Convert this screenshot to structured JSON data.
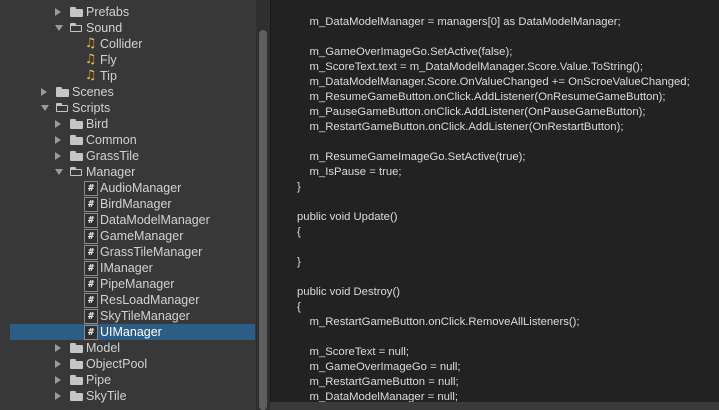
{
  "tree": {
    "items": [
      {
        "label": "Prefabs",
        "kind": "folder",
        "indent": 1,
        "arrow": "closed"
      },
      {
        "label": "Sound",
        "kind": "folder",
        "indent": 1,
        "arrow": "open"
      },
      {
        "label": "Collider",
        "kind": "audio",
        "indent": 2
      },
      {
        "label": "Fly",
        "kind": "audio",
        "indent": 2
      },
      {
        "label": "Tip",
        "kind": "audio",
        "indent": 2
      },
      {
        "label": "Scenes",
        "kind": "folder",
        "indent": 0,
        "arrow": "closed"
      },
      {
        "label": "Scripts",
        "kind": "folder",
        "indent": 0,
        "arrow": "open"
      },
      {
        "label": "Bird",
        "kind": "folder",
        "indent": 1,
        "arrow": "closed"
      },
      {
        "label": "Common",
        "kind": "folder",
        "indent": 1,
        "arrow": "closed"
      },
      {
        "label": "GrassTile",
        "kind": "folder",
        "indent": 1,
        "arrow": "closed"
      },
      {
        "label": "Manager",
        "kind": "folder",
        "indent": 1,
        "arrow": "open"
      },
      {
        "label": "AudioManager",
        "kind": "script",
        "indent": 2
      },
      {
        "label": "BirdManager",
        "kind": "script",
        "indent": 2
      },
      {
        "label": "DataModelManager",
        "kind": "script",
        "indent": 2
      },
      {
        "label": "GameManager",
        "kind": "script",
        "indent": 2
      },
      {
        "label": "GrassTileManager",
        "kind": "script",
        "indent": 2
      },
      {
        "label": "IManager",
        "kind": "script",
        "indent": 2
      },
      {
        "label": "PipeManager",
        "kind": "script",
        "indent": 2
      },
      {
        "label": "ResLoadManager",
        "kind": "script",
        "indent": 2
      },
      {
        "label": "SkyTileManager",
        "kind": "script",
        "indent": 2
      },
      {
        "label": "UIManager",
        "kind": "script",
        "indent": 2,
        "selected": true
      },
      {
        "label": "Model",
        "kind": "folder",
        "indent": 1,
        "arrow": "closed"
      },
      {
        "label": "ObjectPool",
        "kind": "folder",
        "indent": 1,
        "arrow": "closed"
      },
      {
        "label": "Pipe",
        "kind": "folder",
        "indent": 1,
        "arrow": "closed"
      },
      {
        "label": "SkyTile",
        "kind": "folder",
        "indent": 1,
        "arrow": "closed"
      }
    ]
  },
  "code": {
    "lines": [
      "    m_DataModelManager = managers[0] as DataModelManager;",
      "",
      "    m_GameOverImageGo.SetActive(false);",
      "    m_ScoreText.text = m_DataModelManager.Score.Value.ToString();",
      "    m_DataModelManager.Score.OnValueChanged += OnScroeValueChanged;",
      "    m_ResumeGameButton.onClick.AddListener(OnResumeGameButton);",
      "    m_PauseGameButton.onClick.AddListener(OnPauseGameButton);",
      "    m_RestartGameButton.onClick.AddListener(OnRestartButton);",
      "",
      "    m_ResumeGameImageGo.SetActive(true);",
      "    m_IsPause = true;",
      "}",
      "",
      "public void Update()",
      "{",
      "",
      "}",
      "",
      "public void Destroy()",
      "{",
      "    m_RestartGameButton.onClick.RemoveAllListeners();",
      "",
      "    m_ScoreText = null;",
      "    m_GameOverImageGo = null;",
      "    m_RestartGameButton = null;",
      "    m_DataModelManager = null;"
    ]
  },
  "colors": {
    "selection": "#2c5d87",
    "audio_icon": "#e8b53c"
  }
}
